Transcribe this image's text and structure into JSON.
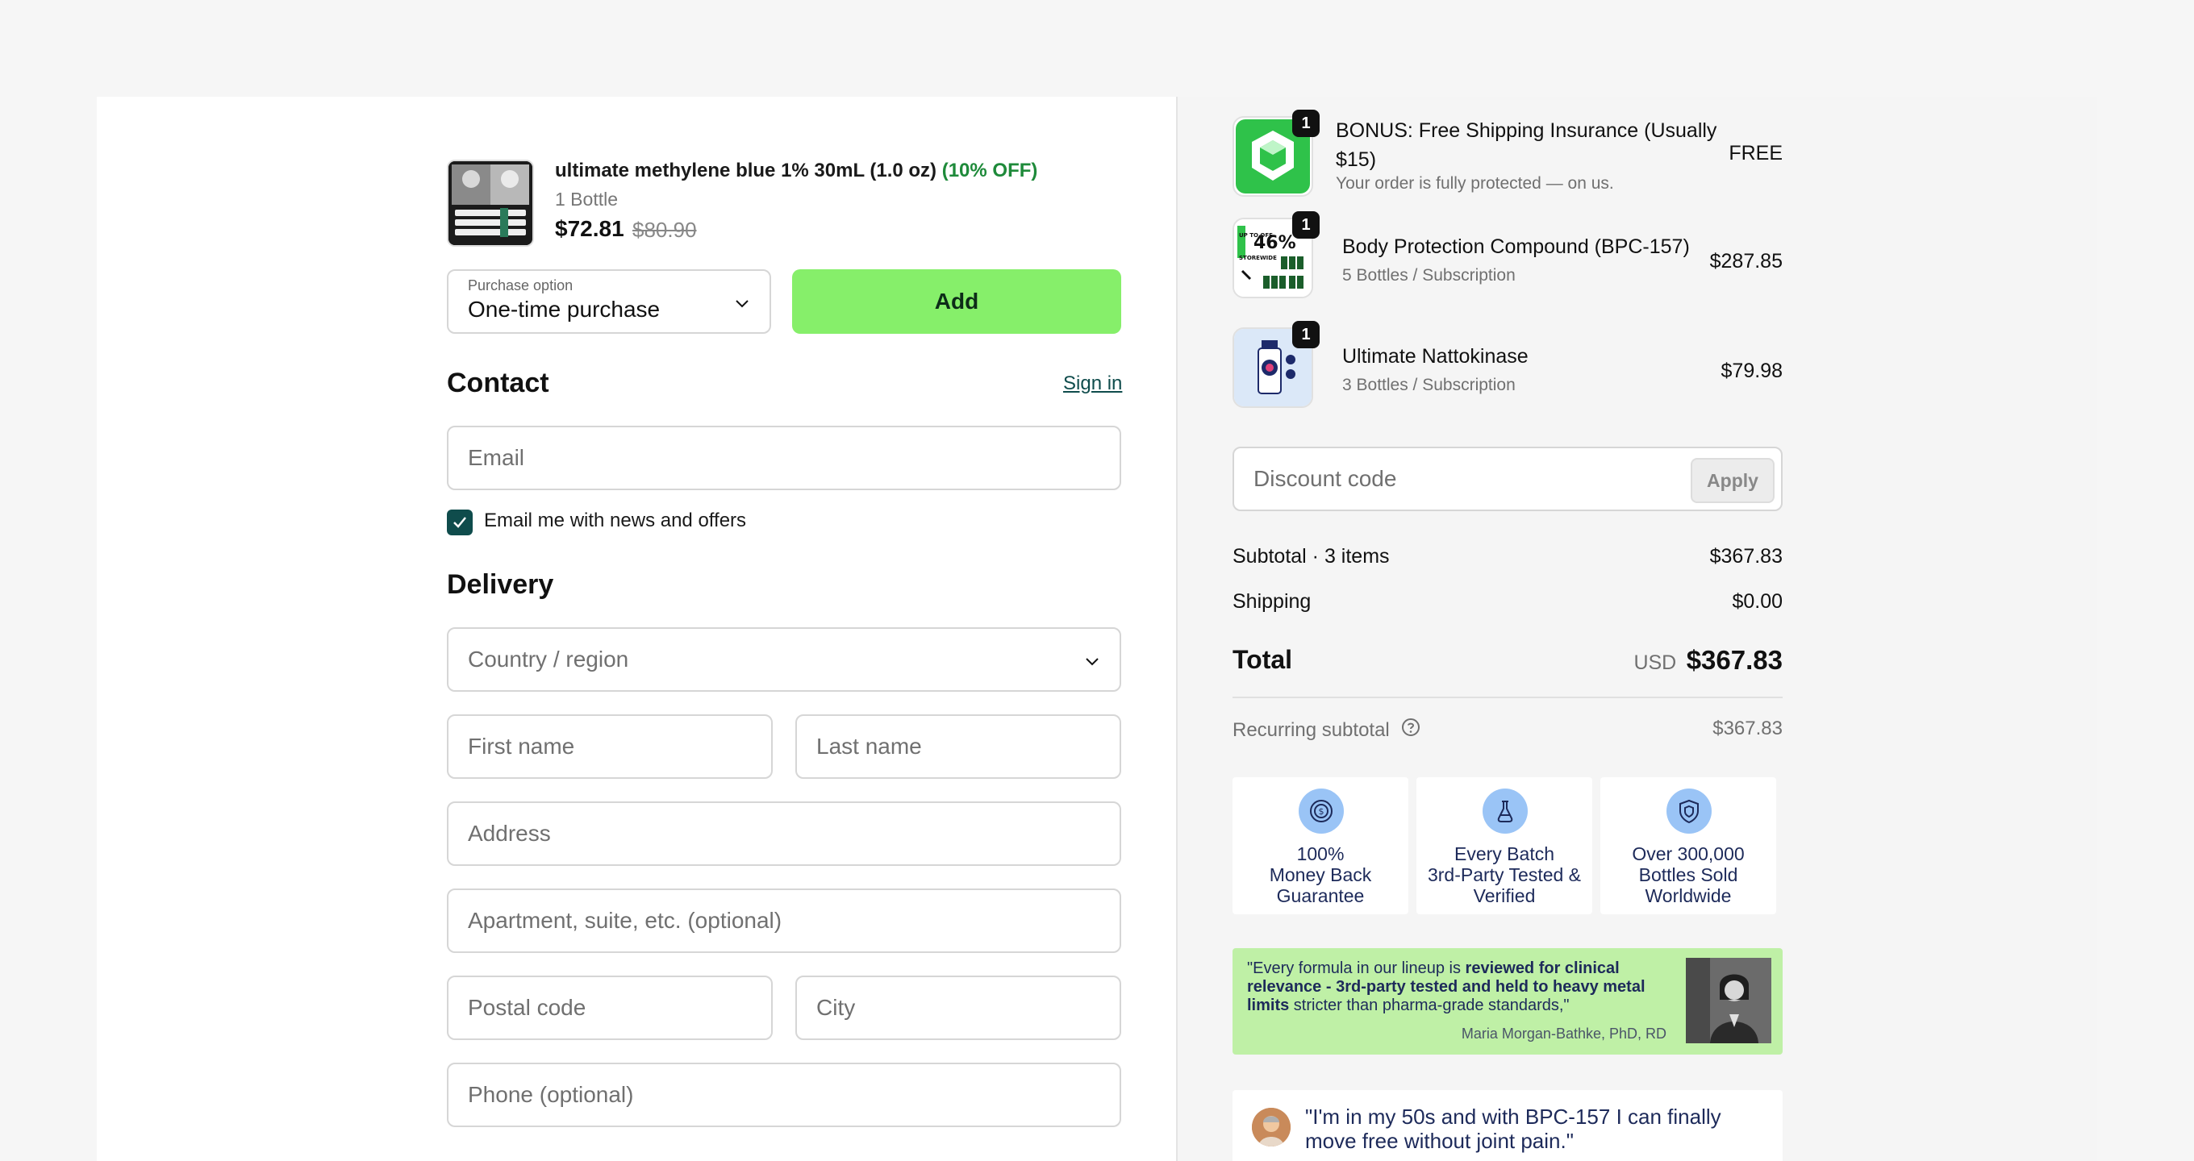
{
  "upsell": {
    "title": "ultimate methylene blue 1% 30mL (1.0 oz)",
    "discount_label": "(10% OFF)",
    "variant": "1 Bottle",
    "price": "$72.81",
    "compare_price": "$80.90",
    "purchase_option_label": "Purchase option",
    "purchase_option_value": "One-time purchase",
    "add_label": "Add"
  },
  "contact": {
    "heading": "Contact",
    "sign_in": "Sign in",
    "email_placeholder": "Email",
    "newsletter_label": "Email me with news and offers",
    "newsletter_checked": true
  },
  "delivery": {
    "heading": "Delivery",
    "country_placeholder": "Country / region",
    "first_name_placeholder": "First name",
    "last_name_placeholder": "Last name",
    "address_placeholder": "Address",
    "apartment_placeholder": "Apartment, suite, etc. (optional)",
    "postal_placeholder": "Postal code",
    "city_placeholder": "City",
    "phone_placeholder": "Phone (optional)"
  },
  "order": {
    "items": [
      {
        "qty": "1",
        "name": "BONUS: Free Shipping Insurance (Usually",
        "name2": "$15)",
        "sub": "Your order is fully protected — on us.",
        "price": "FREE",
        "icon": "shield-box-icon"
      },
      {
        "qty": "1",
        "name": "Body Protection Compound (BPC-157)",
        "sub": "5 Bottles / Subscription",
        "price": "$287.85",
        "thumb_text_a": "UP TO OFF",
        "thumb_text_b": "46%",
        "thumb_text_c": "STOREWIDE"
      },
      {
        "qty": "1",
        "name": "Ultimate Nattokinase",
        "sub": "3 Bottles / Subscription",
        "price": "$79.98"
      }
    ],
    "discount_placeholder": "Discount code",
    "apply_label": "Apply",
    "subtotal_label": "Subtotal · 3 items",
    "subtotal_value": "$367.83",
    "shipping_label": "Shipping",
    "shipping_value": "$0.00",
    "total_label": "Total",
    "total_currency": "USD",
    "total_value": "$367.83",
    "recurring_label": "Recurring subtotal",
    "recurring_value": "$367.83"
  },
  "badges": [
    {
      "line1": "100%",
      "line2": "Money Back",
      "line3": "Guarantee",
      "icon": "dollar-shield-icon"
    },
    {
      "line1": "Every Batch",
      "line2": "3rd-Party Tested &",
      "line3": "Verified",
      "icon": "flask-icon"
    },
    {
      "line1": "Over 300,000",
      "line2": "Bottles Sold",
      "line3": "Worldwide",
      "icon": "shield-icon"
    }
  ],
  "quote": {
    "part1": "\"Every formula in our lineup is ",
    "bold": "reviewed for clinical relevance - 3rd-party tested and held to heavy metal limits",
    "part2": " stricter than pharma-grade standards,\"",
    "author": "Maria Morgan-Bathke, PhD, RD"
  },
  "review": {
    "text": "\"I'm in my 50s and with BPC-157 I can finally move free without joint pain.\""
  },
  "colors": {
    "accent_green": "#86ef6a",
    "dark_teal": "#0f4c4c",
    "discount_green": "#1e8a3a",
    "quote_bg": "#bff0a6",
    "badge_icon": "#9ac4f6"
  }
}
